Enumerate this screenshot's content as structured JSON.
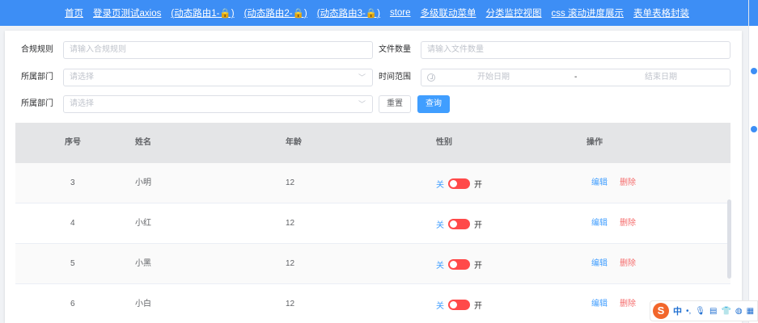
{
  "nav": {
    "items": [
      "首页",
      "登录页测试axios",
      "(动态路由1-🔒)",
      "(动态路由2-🔒)",
      "(动态路由3-🔒)",
      "store",
      "多级联动菜单",
      "分类监控视图",
      "css 滚动进度展示",
      "表单表格封装"
    ]
  },
  "form": {
    "rule_label": "合规规则",
    "rule_placeholder": "请输入合规规则",
    "count_label": "文件数量",
    "count_placeholder": "请输入文件数量",
    "dept_label": "所属部门",
    "dept_placeholder": "请选择",
    "time_label": "时间范围",
    "start_placeholder": "开始日期",
    "range_sep": "-",
    "end_placeholder": "结束日期",
    "dept2_label": "所属部门",
    "dept2_placeholder": "请选择",
    "reset_label": "重置",
    "query_label": "查询"
  },
  "table": {
    "headers": [
      "序号",
      "姓名",
      "年龄",
      "性别",
      "操作"
    ],
    "rows": [
      {
        "id": "3",
        "name": "小明",
        "age": "12",
        "off": "关",
        "on": "开",
        "edit": "编辑",
        "del": "删除"
      },
      {
        "id": "4",
        "name": "小红",
        "age": "12",
        "off": "关",
        "on": "开",
        "edit": "编辑",
        "del": "删除"
      },
      {
        "id": "5",
        "name": "小黑",
        "age": "12",
        "off": "关",
        "on": "开",
        "edit": "编辑",
        "del": "删除"
      },
      {
        "id": "6",
        "name": "小白",
        "age": "12",
        "off": "关",
        "on": "开",
        "edit": "编辑",
        "del": "删除"
      }
    ]
  },
  "ime": {
    "logo": "S",
    "lang": "中",
    "icons": [
      "punctuation-icon",
      "microphone-icon",
      "keyboard-icon",
      "shirt-icon",
      "game-icon",
      "grid-icon"
    ]
  },
  "colors": {
    "primary": "#409eff",
    "nav": "#3d8ef5",
    "switch_off": "#ff4949",
    "danger": "#f56c6c"
  }
}
